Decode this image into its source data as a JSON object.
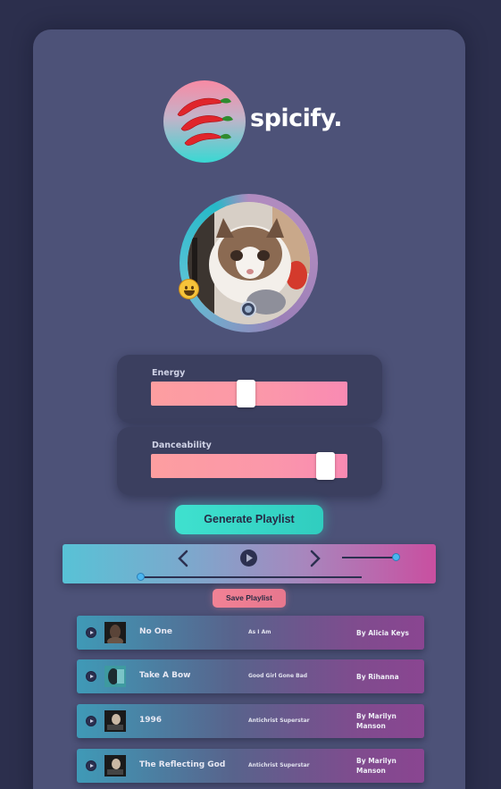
{
  "app": {
    "name": "spicify."
  },
  "colors": {
    "background": "#2c2f4d",
    "card": "#4d5278",
    "accent_teal": "#3fe1cf",
    "accent_pink": "#f18295",
    "slider_gradient_start": "#fd9ea0",
    "slider_gradient_end": "#f98ab3"
  },
  "icons": {
    "logo": "chili-peppers-icon",
    "emoji": "smiley-face-icon",
    "camera": "camera-icon",
    "prev": "chevron-left-icon",
    "play": "play-circle-icon",
    "next": "chevron-right-icon"
  },
  "sliders": [
    {
      "label": "Energy",
      "value": 0.48
    },
    {
      "label": "Danceability",
      "value": 0.93
    }
  ],
  "buttons": {
    "generate": "Generate Playlist",
    "save": "Save Playlist"
  },
  "player": {
    "volume": 1.0,
    "progress": 0.0
  },
  "tracks": [
    {
      "title": "No One",
      "album": "As I Am",
      "artist": "By Alicia Keys"
    },
    {
      "title": "Take A Bow",
      "album": "Good Girl Gone Bad",
      "artist": "By Rihanna"
    },
    {
      "title": "1996",
      "album": "Antichrist Superstar",
      "artist": "By Marilyn Manson"
    },
    {
      "title": "The Reflecting God",
      "album": "Antichrist Superstar",
      "artist": "By Marilyn Manson"
    }
  ]
}
